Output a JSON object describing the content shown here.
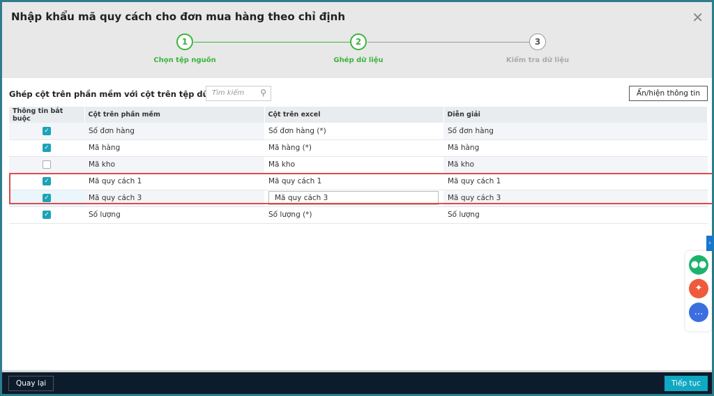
{
  "title": "Nhập khẩu mã quy cách cho đơn mua hàng theo chỉ định",
  "steps": [
    {
      "num": "1",
      "label": "Chọn tệp nguồn",
      "state": "done"
    },
    {
      "num": "2",
      "label": "Ghép dữ liệu",
      "state": "active"
    },
    {
      "num": "3",
      "label": "Kiểm tra dữ liệu",
      "state": "pending"
    }
  ],
  "subtitle": "Ghép cột trên phần mềm với cột trên tệp dữ liệu",
  "search": {
    "placeholder": "Tìm kiếm"
  },
  "toggle_label": "Ẩn/hiện thông tin",
  "table": {
    "headers": [
      "Thông tin bắt buộc",
      "Cột trên phần mềm",
      "Cột trên excel",
      "Diễn giải"
    ],
    "rows": [
      {
        "required": true,
        "software": "Số đơn hàng",
        "excel": "Số đơn hàng (*)",
        "desc": "Số đơn hàng"
      },
      {
        "required": true,
        "software": "Mã hàng",
        "excel": "Mã hàng (*)",
        "desc": "Mã hàng"
      },
      {
        "required": false,
        "software": "Mã kho",
        "excel": "Mã kho",
        "desc": "Mã kho"
      },
      {
        "required": true,
        "software": "Mã quy cách 1",
        "excel": "Mã quy cách 1",
        "desc": "Mã quy cách 1"
      },
      {
        "required": true,
        "software": "Mã quy cách 3",
        "excel": "Mã quy cách 3",
        "desc": "Mã quy cách 3"
      },
      {
        "required": true,
        "software": "Số lượng",
        "excel": "Số lượng (*)",
        "desc": "Số lượng"
      }
    ]
  },
  "footer": {
    "back": "Quay lại",
    "next": "Tiếp tục"
  },
  "colors": {
    "accent": "#3cb33c",
    "checkbox": "#1aa3b8",
    "highlight": "#e04a4a",
    "footer": "#0c1c2c"
  },
  "side_icons": [
    "chatbot-icon",
    "sparkle-icon",
    "chat-bubble-icon"
  ]
}
